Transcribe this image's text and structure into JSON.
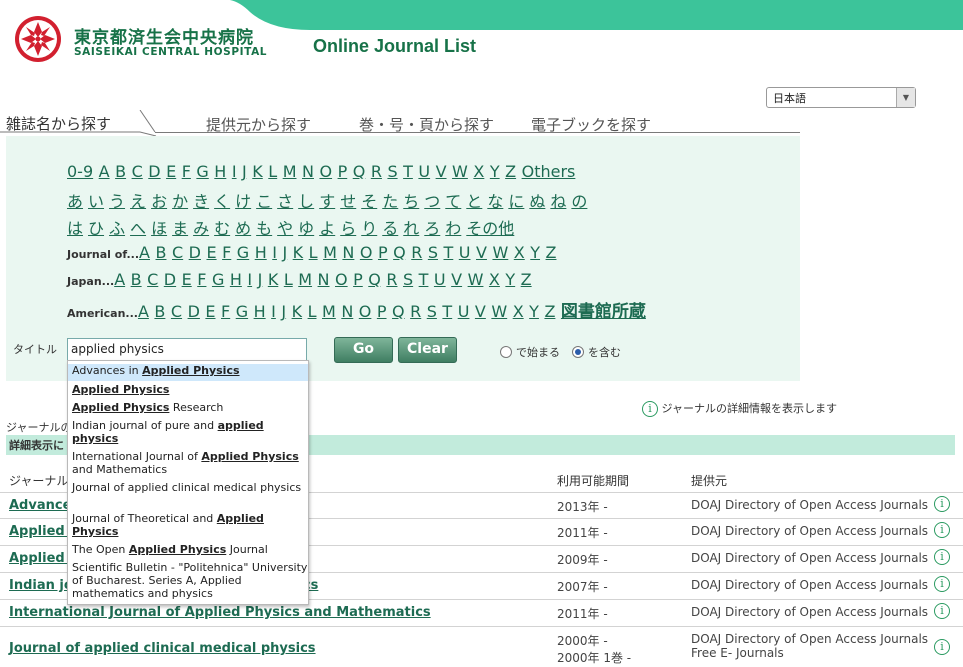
{
  "header": {
    "hospital_jp": "東京都済生会中央病院",
    "hospital_en": "SAISEIKAI CENTRAL HOSPITAL",
    "site_title": "Online Journal List",
    "brand_color": "#177248",
    "accent_color": "#3cc49a"
  },
  "language": {
    "selected": "日本語"
  },
  "tabs": [
    {
      "label": "雑誌名から探す",
      "active": true
    },
    {
      "label": "提供元から探す",
      "active": false
    },
    {
      "label": "巻・号・頁から探す",
      "active": false
    },
    {
      "label": "電子ブックを探す",
      "active": false
    }
  ],
  "alpha": {
    "latin": [
      "0-9",
      "A",
      "B",
      "C",
      "D",
      "E",
      "F",
      "G",
      "H",
      "I",
      "J",
      "K",
      "L",
      "M",
      "N",
      "O",
      "P",
      "Q",
      "R",
      "S",
      "T",
      "U",
      "V",
      "W",
      "X",
      "Y",
      "Z",
      "Others"
    ],
    "kana1": [
      "あ",
      "い",
      "う",
      "え",
      "お",
      "か",
      "き",
      "く",
      "け",
      "こ",
      "さ",
      "し",
      "す",
      "せ",
      "そ",
      "た",
      "ち",
      "つ",
      "て",
      "と",
      "な",
      "に",
      "ぬ",
      "ね",
      "の"
    ],
    "kana2": [
      "は",
      "ひ",
      "ふ",
      "へ",
      "ほ",
      "ま",
      "み",
      "む",
      "め",
      "も",
      "や",
      "ゆ",
      "よ",
      "ら",
      "り",
      "る",
      "れ",
      "ろ",
      "わ",
      "その他"
    ],
    "journal_prefix": "Journal of...",
    "japan_prefix": "Japan...",
    "american_prefix": "American...",
    "letters": [
      "A",
      "B",
      "C",
      "D",
      "E",
      "F",
      "G",
      "H",
      "I",
      "J",
      "K",
      "L",
      "M",
      "N",
      "O",
      "P",
      "Q",
      "R",
      "S",
      "T",
      "U",
      "V",
      "W",
      "X",
      "Y",
      "Z"
    ],
    "library_link": "図書館所蔵"
  },
  "search": {
    "label": "タイトル",
    "value": "applied physics",
    "go": "Go",
    "clear": "Clear",
    "radio_starts": "で始まる",
    "radio_contains": "を含む",
    "selected": "contains"
  },
  "autocomplete": [
    {
      "pre": "Advances in ",
      "match": "Applied Physics",
      "post": "",
      "highlighted": true
    },
    {
      "pre": "",
      "match": "Applied Physics",
      "post": ""
    },
    {
      "pre": "",
      "match": "Applied Physics",
      "post": " Research"
    },
    {
      "pre": "Indian journal of pure and ",
      "match": "applied physics",
      "post": ""
    },
    {
      "pre": "International Journal of ",
      "match": "Applied Physics",
      "post": " and Mathematics"
    },
    {
      "pre": "Journal of applied clinical medical physics",
      "match": "",
      "post": ""
    },
    {
      "pre": "Journal of Theoretical and ",
      "match": "Applied Physics",
      "post": ""
    },
    {
      "pre": "The Open ",
      "match": "Applied Physics",
      "post": " Journal"
    },
    {
      "pre": "Scientific Bulletin - \"Politehnica\" University of Bucharest. Series A, Applied mathematics and physics",
      "match": "",
      "post": ""
    }
  ],
  "info_text": "ジャーナルの詳細情報を表示します",
  "count_text": "ジャーナルの",
  "band_text": "詳細表示に",
  "table": {
    "headers": {
      "title": "ジャーナル",
      "period": "利用可能期間",
      "provider": "提供元"
    },
    "rows": [
      {
        "title": "Advances in Applied Physics",
        "period": "2013年 -",
        "provider": "DOAJ Directory of Open Access Journals"
      },
      {
        "title": "Applied Physics",
        "period": "2011年 -",
        "provider": "DOAJ Directory of Open Access Journals"
      },
      {
        "title": "Applied Physics Research",
        "period": "2009年 -",
        "provider": "DOAJ Directory of Open Access Journals"
      },
      {
        "title": "Indian journal of pure and applied physics",
        "period": "2007年 -",
        "provider": "DOAJ Directory of Open Access Journals"
      },
      {
        "title": "International Journal of Applied Physics and Mathematics",
        "period": "2011年 -",
        "provider": "DOAJ Directory of Open Access Journals"
      },
      {
        "title": "Journal of applied clinical medical physics",
        "period": "2000年 -",
        "period2": "2000年 1巻 -",
        "provider": "DOAJ Directory of Open Access Journals",
        "provider2": "Free E- Journals"
      }
    ]
  }
}
